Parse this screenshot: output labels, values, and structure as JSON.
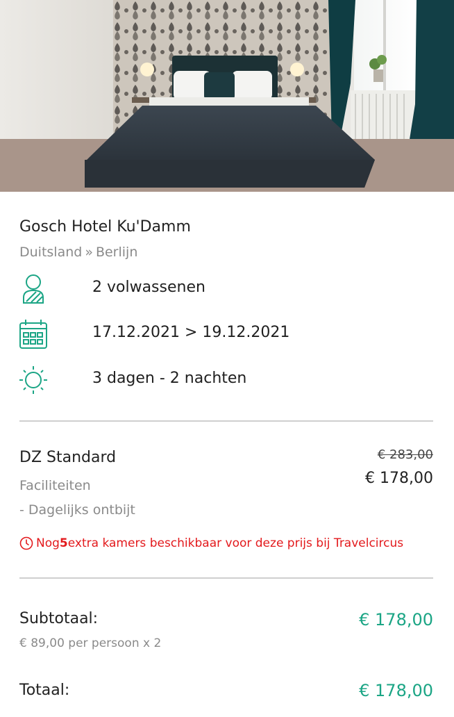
{
  "hotel": {
    "name": "Gosch Hotel Ku'Damm",
    "country": "Duitsland",
    "separator": "»",
    "city": "Berlijn"
  },
  "details": {
    "guests": "2 volwassenen",
    "dates": "17.12.2021 > 19.12.2021",
    "duration": "3 dagen - 2 nachten",
    "icons": [
      "person-icon",
      "calendar-icon",
      "sun-icon"
    ]
  },
  "room": {
    "name": "DZ Standard",
    "old_price": "€ 283,00",
    "price": "€ 178,00",
    "facilities_title": "Faciliteiten",
    "facility_item": "- Dagelijks ontbijt"
  },
  "alert": {
    "prefix": "Nog ",
    "count": "5",
    "suffix": " extra kamers beschikbaar voor deze prijs bij Travelcircus"
  },
  "summary": {
    "subtotal_label": "Subtotaal:",
    "subtotal_value": "€ 178,00",
    "per_person": "€ 89,00 per persoon x 2",
    "total_label": "Totaal:",
    "total_value": "€ 178,00"
  },
  "colors": {
    "accent": "#1ba585",
    "alert": "#e3191c",
    "muted": "#8a8a8a"
  }
}
